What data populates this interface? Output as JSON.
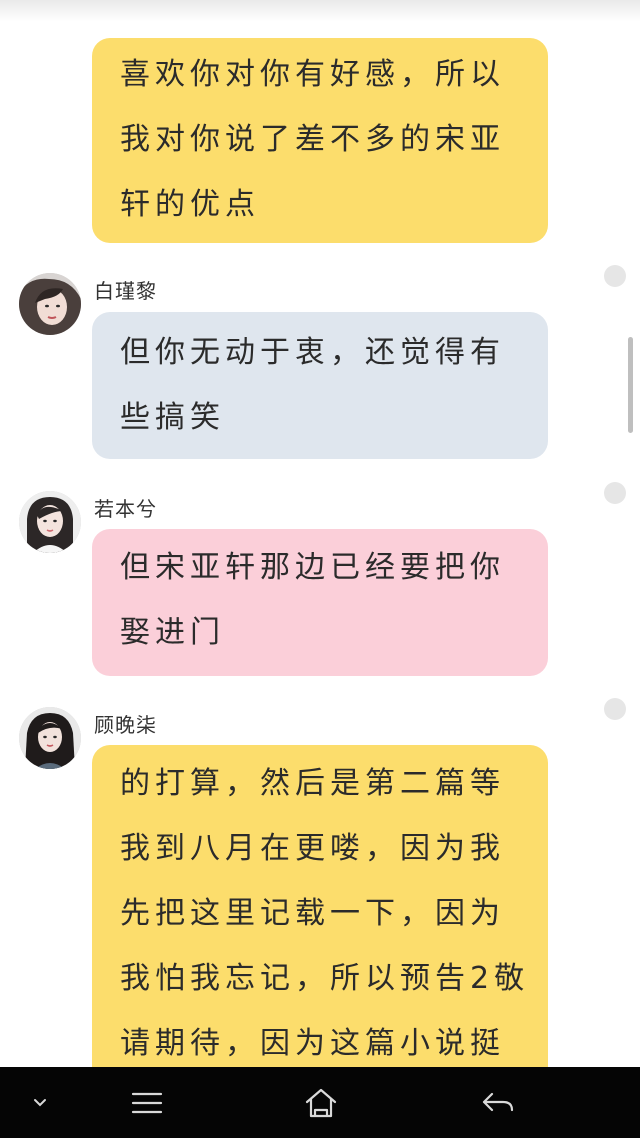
{
  "chat": {
    "messages": [
      {
        "sender": "",
        "color": "#fcdd6c",
        "lines": [
          "喜欢你对你有好感，所以",
          "我对你说了差不多的宋亚",
          "轩的优点"
        ]
      },
      {
        "sender": "白瑾黎",
        "color": "#dfe6ee",
        "lines": [
          "但你无动于衷，还觉得有",
          "些搞笑"
        ]
      },
      {
        "sender": "若本兮",
        "color": "#fbcfd9",
        "lines": [
          "但宋亚轩那边已经要把你",
          "娶进门"
        ]
      },
      {
        "sender": "顾晚柒",
        "color": "#fcdd6c",
        "lines": [
          "的打算，然后是第二篇等",
          "我到八月在更喽，因为我",
          "先把这里记载一下，因为",
          "我怕我忘记，所以预告2敬",
          "请期待，因为这篇小说挺"
        ]
      }
    ]
  },
  "navbar": {
    "icons": [
      "chevron-down-icon",
      "menu-icon",
      "home-icon",
      "back-icon"
    ]
  }
}
